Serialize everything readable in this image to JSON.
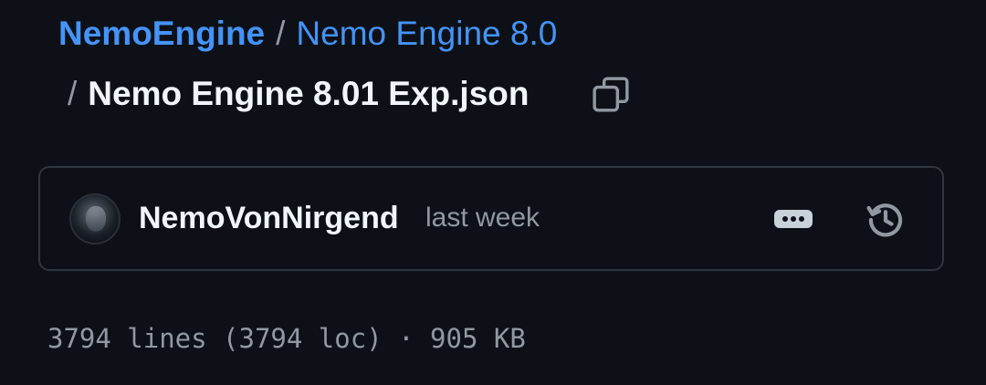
{
  "breadcrumb": {
    "owner": "NemoEngine",
    "separator": "/",
    "folder": "Nemo Engine 8.0",
    "file": "Nemo Engine 8.01 Exp.json"
  },
  "copy_icon": "copy-icon",
  "commit": {
    "author": "NemoVonNirgend",
    "time": "last week",
    "more_icon": "kebab-horizontal-icon",
    "history_icon": "history-icon"
  },
  "file_meta": "3794 lines (3794 loc) · 905 KB",
  "colors": {
    "background": "#0d1117",
    "link": "#4493f8",
    "muted": "#9198a1",
    "border": "#30363d",
    "text": "#f0f6fc"
  }
}
